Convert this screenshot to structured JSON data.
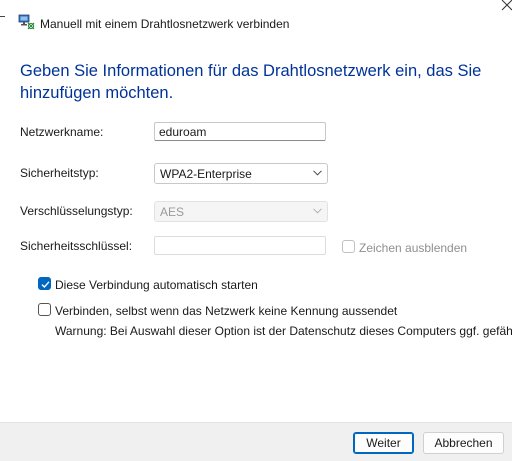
{
  "window": {
    "title": "Manuell mit einem Drahtlosnetzwerk verbinden",
    "title_icon": "network-adapter-icon",
    "close_icon": "close-icon"
  },
  "heading": "Geben Sie Informationen für das Drahtlosnetzwerk ein, das Sie hinzufügen möchten.",
  "form": {
    "network_name": {
      "label": "Netzwerkname:",
      "value": "eduroam"
    },
    "security_type": {
      "label": "Sicherheitstyp:",
      "value": "WPA2-Enterprise"
    },
    "encryption_type": {
      "label": "Verschlüsselungstyp:",
      "value": "AES",
      "disabled": true
    },
    "security_key": {
      "label": "Sicherheitsschlüssel:",
      "value": "",
      "disabled": true
    },
    "hide_characters": {
      "label": "Zeichen ausblenden",
      "checked": false,
      "disabled": true
    }
  },
  "options": {
    "auto_start": {
      "label": "Diese Verbindung automatisch starten",
      "checked": true
    },
    "connect_hidden": {
      "label": "Verbinden, selbst wenn das Netzwerk keine Kennung aussendet",
      "checked": false
    },
    "warning": "Warnung: Bei Auswahl dieser Option ist der Datenschutz dieses Computers ggf. gefährdet."
  },
  "buttons": {
    "next": "Weiter",
    "cancel": "Abbrechen"
  },
  "colors": {
    "heading": "#003399",
    "accent": "#0067c0",
    "footer_bg": "#f0f0f0"
  }
}
